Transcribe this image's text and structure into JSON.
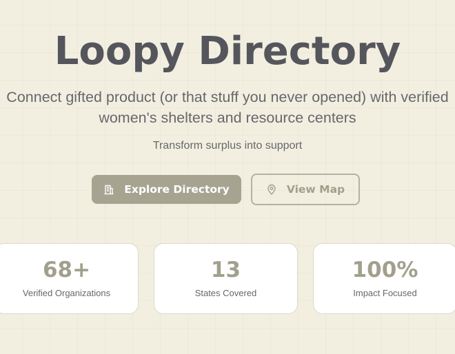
{
  "hero": {
    "title": "Loopy Directory",
    "subtitle": "Connect gifted product (or that stuff you never opened) with verified women's shelters and resource centers",
    "tagline": "Transform surplus into support"
  },
  "actions": {
    "explore": {
      "label": "Explore Directory",
      "icon": "building-icon"
    },
    "map": {
      "label": "View Map",
      "icon": "map-pin-icon"
    }
  },
  "stats": [
    {
      "value": "68+",
      "label": "Verified Organizations"
    },
    {
      "value": "13",
      "label": "States Covered"
    },
    {
      "value": "100%",
      "label": "Impact Focused"
    }
  ],
  "colors": {
    "background": "#f2efe1",
    "title_text": "#55565c",
    "accent": "#a6a490",
    "card_background": "#ffffff"
  }
}
